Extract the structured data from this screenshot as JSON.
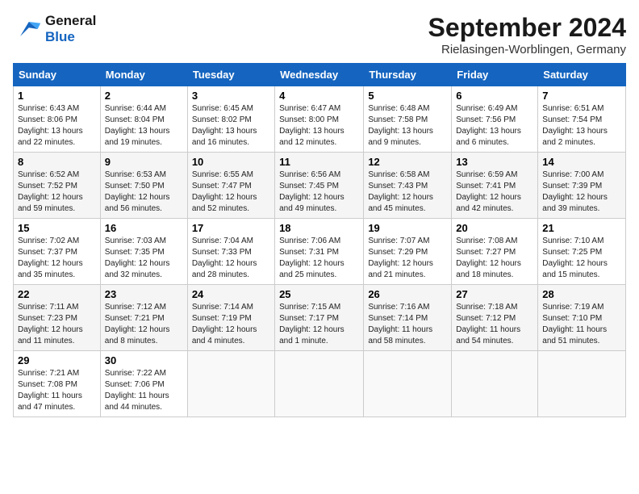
{
  "logo": {
    "line1": "General",
    "line2": "Blue"
  },
  "title": "September 2024",
  "location": "Rielasingen-Worblingen, Germany",
  "headers": [
    "Sunday",
    "Monday",
    "Tuesday",
    "Wednesday",
    "Thursday",
    "Friday",
    "Saturday"
  ],
  "weeks": [
    [
      {
        "day": "1",
        "sunrise": "Sunrise: 6:43 AM",
        "sunset": "Sunset: 8:06 PM",
        "daylight": "Daylight: 13 hours and 22 minutes."
      },
      {
        "day": "2",
        "sunrise": "Sunrise: 6:44 AM",
        "sunset": "Sunset: 8:04 PM",
        "daylight": "Daylight: 13 hours and 19 minutes."
      },
      {
        "day": "3",
        "sunrise": "Sunrise: 6:45 AM",
        "sunset": "Sunset: 8:02 PM",
        "daylight": "Daylight: 13 hours and 16 minutes."
      },
      {
        "day": "4",
        "sunrise": "Sunrise: 6:47 AM",
        "sunset": "Sunset: 8:00 PM",
        "daylight": "Daylight: 13 hours and 12 minutes."
      },
      {
        "day": "5",
        "sunrise": "Sunrise: 6:48 AM",
        "sunset": "Sunset: 7:58 PM",
        "daylight": "Daylight: 13 hours and 9 minutes."
      },
      {
        "day": "6",
        "sunrise": "Sunrise: 6:49 AM",
        "sunset": "Sunset: 7:56 PM",
        "daylight": "Daylight: 13 hours and 6 minutes."
      },
      {
        "day": "7",
        "sunrise": "Sunrise: 6:51 AM",
        "sunset": "Sunset: 7:54 PM",
        "daylight": "Daylight: 13 hours and 2 minutes."
      }
    ],
    [
      {
        "day": "8",
        "sunrise": "Sunrise: 6:52 AM",
        "sunset": "Sunset: 7:52 PM",
        "daylight": "Daylight: 12 hours and 59 minutes."
      },
      {
        "day": "9",
        "sunrise": "Sunrise: 6:53 AM",
        "sunset": "Sunset: 7:50 PM",
        "daylight": "Daylight: 12 hours and 56 minutes."
      },
      {
        "day": "10",
        "sunrise": "Sunrise: 6:55 AM",
        "sunset": "Sunset: 7:47 PM",
        "daylight": "Daylight: 12 hours and 52 minutes."
      },
      {
        "day": "11",
        "sunrise": "Sunrise: 6:56 AM",
        "sunset": "Sunset: 7:45 PM",
        "daylight": "Daylight: 12 hours and 49 minutes."
      },
      {
        "day": "12",
        "sunrise": "Sunrise: 6:58 AM",
        "sunset": "Sunset: 7:43 PM",
        "daylight": "Daylight: 12 hours and 45 minutes."
      },
      {
        "day": "13",
        "sunrise": "Sunrise: 6:59 AM",
        "sunset": "Sunset: 7:41 PM",
        "daylight": "Daylight: 12 hours and 42 minutes."
      },
      {
        "day": "14",
        "sunrise": "Sunrise: 7:00 AM",
        "sunset": "Sunset: 7:39 PM",
        "daylight": "Daylight: 12 hours and 39 minutes."
      }
    ],
    [
      {
        "day": "15",
        "sunrise": "Sunrise: 7:02 AM",
        "sunset": "Sunset: 7:37 PM",
        "daylight": "Daylight: 12 hours and 35 minutes."
      },
      {
        "day": "16",
        "sunrise": "Sunrise: 7:03 AM",
        "sunset": "Sunset: 7:35 PM",
        "daylight": "Daylight: 12 hours and 32 minutes."
      },
      {
        "day": "17",
        "sunrise": "Sunrise: 7:04 AM",
        "sunset": "Sunset: 7:33 PM",
        "daylight": "Daylight: 12 hours and 28 minutes."
      },
      {
        "day": "18",
        "sunrise": "Sunrise: 7:06 AM",
        "sunset": "Sunset: 7:31 PM",
        "daylight": "Daylight: 12 hours and 25 minutes."
      },
      {
        "day": "19",
        "sunrise": "Sunrise: 7:07 AM",
        "sunset": "Sunset: 7:29 PM",
        "daylight": "Daylight: 12 hours and 21 minutes."
      },
      {
        "day": "20",
        "sunrise": "Sunrise: 7:08 AM",
        "sunset": "Sunset: 7:27 PM",
        "daylight": "Daylight: 12 hours and 18 minutes."
      },
      {
        "day": "21",
        "sunrise": "Sunrise: 7:10 AM",
        "sunset": "Sunset: 7:25 PM",
        "daylight": "Daylight: 12 hours and 15 minutes."
      }
    ],
    [
      {
        "day": "22",
        "sunrise": "Sunrise: 7:11 AM",
        "sunset": "Sunset: 7:23 PM",
        "daylight": "Daylight: 12 hours and 11 minutes."
      },
      {
        "day": "23",
        "sunrise": "Sunrise: 7:12 AM",
        "sunset": "Sunset: 7:21 PM",
        "daylight": "Daylight: 12 hours and 8 minutes."
      },
      {
        "day": "24",
        "sunrise": "Sunrise: 7:14 AM",
        "sunset": "Sunset: 7:19 PM",
        "daylight": "Daylight: 12 hours and 4 minutes."
      },
      {
        "day": "25",
        "sunrise": "Sunrise: 7:15 AM",
        "sunset": "Sunset: 7:17 PM",
        "daylight": "Daylight: 12 hours and 1 minute."
      },
      {
        "day": "26",
        "sunrise": "Sunrise: 7:16 AM",
        "sunset": "Sunset: 7:14 PM",
        "daylight": "Daylight: 11 hours and 58 minutes."
      },
      {
        "day": "27",
        "sunrise": "Sunrise: 7:18 AM",
        "sunset": "Sunset: 7:12 PM",
        "daylight": "Daylight: 11 hours and 54 minutes."
      },
      {
        "day": "28",
        "sunrise": "Sunrise: 7:19 AM",
        "sunset": "Sunset: 7:10 PM",
        "daylight": "Daylight: 11 hours and 51 minutes."
      }
    ],
    [
      {
        "day": "29",
        "sunrise": "Sunrise: 7:21 AM",
        "sunset": "Sunset: 7:08 PM",
        "daylight": "Daylight: 11 hours and 47 minutes."
      },
      {
        "day": "30",
        "sunrise": "Sunrise: 7:22 AM",
        "sunset": "Sunset: 7:06 PM",
        "daylight": "Daylight: 11 hours and 44 minutes."
      },
      null,
      null,
      null,
      null,
      null
    ]
  ]
}
